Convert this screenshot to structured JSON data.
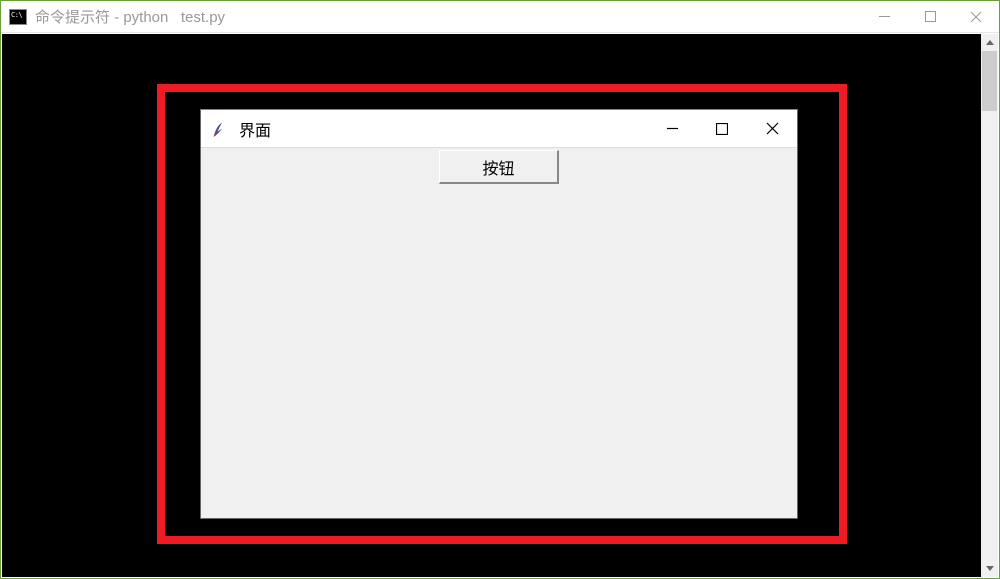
{
  "outer_window": {
    "title": "命令提示符 - python   test.py",
    "controls": {
      "minimize": "—",
      "maximize": "□",
      "close": "×"
    }
  },
  "inner_window": {
    "title": "界面",
    "controls": {
      "minimize": "—",
      "maximize": "□",
      "close": "×"
    },
    "button_label": "按钮"
  }
}
